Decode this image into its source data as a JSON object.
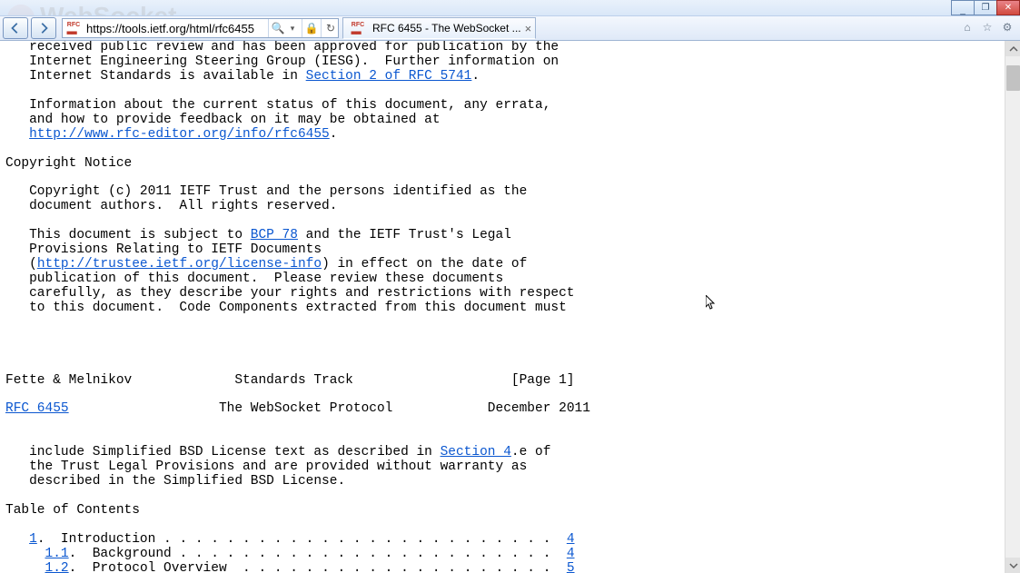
{
  "window": {
    "min": "_",
    "max": "❐",
    "close": "✕"
  },
  "faint": "WebSocket",
  "nav": {
    "back": "back",
    "forward": "forward"
  },
  "address": {
    "url": "https://tools.ietf.org/html/rfc6455",
    "search": "🔍",
    "dropdown": "▾",
    "lock": "🔒",
    "refresh": "↻"
  },
  "tab": {
    "title": "RFC 6455 - The WebSocket ...",
    "favicon": "RFC",
    "close": "×"
  },
  "righticons": {
    "home": "⌂",
    "star": "☆",
    "gear": "⚙"
  },
  "doc": {
    "l1": "   received public review and has been approved for publication by the",
    "l2": "   Internet Engineering Steering Group (IESG).  Further information on",
    "l3a": "   Internet Standards is available in ",
    "l3b": "Section 2 of RFC 5741",
    "l3c": ".",
    "l4": "",
    "l5": "   Information about the current status of this document, any errata,",
    "l6": "   and how to provide feedback on it may be obtained at",
    "l7a": "   ",
    "l7b": "http://www.rfc-editor.org/info/rfc6455",
    "l7c": ".",
    "l8": "",
    "l9": "Copyright Notice",
    "l10": "",
    "l11": "   Copyright (c) 2011 IETF Trust and the persons identified as the",
    "l12": "   document authors.  All rights reserved.",
    "l13": "",
    "l14a": "   This document is subject to ",
    "l14b": "BCP 78",
    "l14c": " and the IETF Trust's Legal",
    "l15": "   Provisions Relating to IETF Documents",
    "l16a": "   (",
    "l16b": "http://trustee.ietf.org/license-info",
    "l16c": ") in effect on the date of",
    "l17": "   publication of this document.  Please review these documents",
    "l18": "   carefully, as they describe your rights and restrictions with respect",
    "l19": "   to this document.  Code Components extracted from this document must",
    "l20": "",
    "l21": "",
    "l22": "",
    "l23": "",
    "l24": "Fette & Melnikov             Standards Track                    [Page 1]",
    "l25": "",
    "l26a": "RFC 6455",
    "l26b": "                   The WebSocket Protocol            December 2011",
    "l27": "",
    "l28": "",
    "l29a": "   include Simplified BSD License text as described in ",
    "l29b": "Section 4",
    "l29c": ".e of",
    "l30": "   the Trust Legal Provisions and are provided without warranty as",
    "l31": "   described in the Simplified BSD License.",
    "l32": "",
    "l33": "Table of Contents",
    "l34": "",
    "l35a": "   ",
    "l35b": "1",
    "l35c": ".  Introduction . . . . . . . . . . . . . . . . . . . . . . . . .  ",
    "l35d": "4",
    "l36a": "     ",
    "l36b": "1.1",
    "l36c": ".  Background . . . . . . . . . . . . . . . . . . . . . . . .  ",
    "l36d": "4",
    "l37a": "     ",
    "l37b": "1.2",
    "l37c": ".  Protocol Overview  . . . . . . . . . . . . . . . . . . . .  ",
    "l37d": "5"
  }
}
